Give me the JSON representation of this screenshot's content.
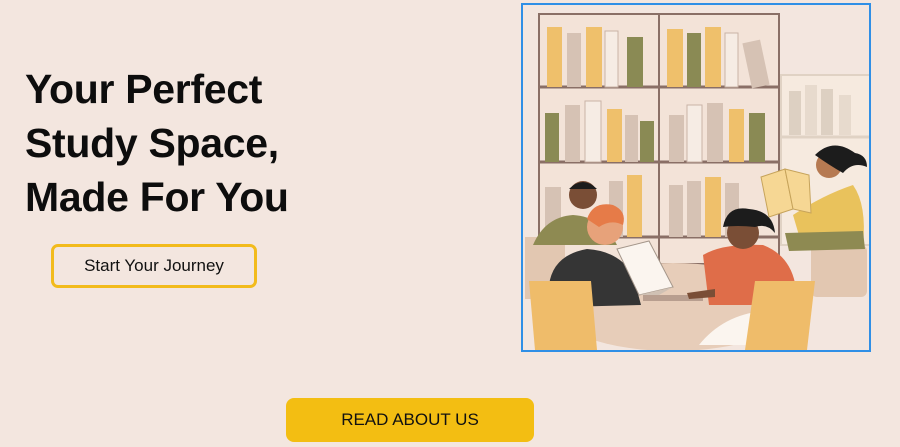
{
  "hero": {
    "title_lines": [
      "Your Perfect",
      "Study Space,",
      "Made For You"
    ]
  },
  "buttons": {
    "start_journey": "Start Your Journey",
    "read_about": "READ ABOUT US"
  },
  "colors": {
    "page_background": "#f3e6df",
    "accent_yellow": "#f3be12",
    "frame_blue": "#2f8fe6"
  },
  "illustration": {
    "subject": "people-reading-in-library-icon"
  }
}
